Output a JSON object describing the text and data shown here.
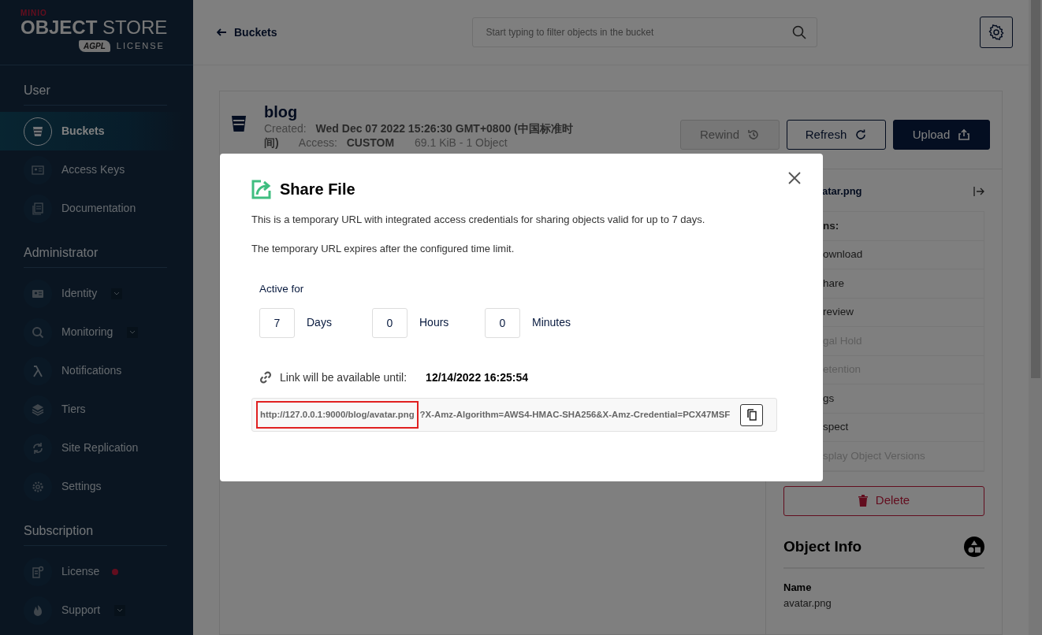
{
  "sidebar": {
    "logo": {
      "brand": "MINIO",
      "title_bold": "OBJECT",
      "title_light": "STORE",
      "badge": "AGPL",
      "edition": "LICENSE"
    },
    "sections": [
      {
        "title": "User",
        "items": [
          {
            "label": "Buckets",
            "kind": "bucket",
            "selected": true,
            "expandable": false,
            "alert": false
          },
          {
            "label": "Access Keys",
            "kind": "id",
            "selected": false,
            "expandable": false,
            "alert": false
          },
          {
            "label": "Documentation",
            "kind": "doc",
            "selected": false,
            "expandable": false,
            "alert": false
          }
        ]
      },
      {
        "title": "Administrator",
        "items": [
          {
            "label": "Identity",
            "kind": "card",
            "selected": false,
            "expandable": true,
            "alert": false
          },
          {
            "label": "Monitoring",
            "kind": "search",
            "selected": false,
            "expandable": true,
            "alert": false
          },
          {
            "label": "Notifications",
            "kind": "lambda",
            "selected": false,
            "expandable": false,
            "alert": false
          },
          {
            "label": "Tiers",
            "kind": "layers",
            "selected": false,
            "expandable": false,
            "alert": false
          },
          {
            "label": "Site Replication",
            "kind": "sync",
            "selected": false,
            "expandable": false,
            "alert": false
          },
          {
            "label": "Settings",
            "kind": "gear",
            "selected": false,
            "expandable": false,
            "alert": false
          }
        ]
      },
      {
        "title": "Subscription",
        "items": [
          {
            "label": "License",
            "kind": "license",
            "selected": false,
            "expandable": false,
            "alert": true
          },
          {
            "label": "Support",
            "kind": "flame",
            "selected": false,
            "expandable": true,
            "alert": false
          }
        ]
      }
    ]
  },
  "topbar": {
    "back": "Buckets",
    "search": {
      "placeholder": "Start typing to filter objects in the bucket"
    }
  },
  "bucket": {
    "name": "blog",
    "created_label": "Created:",
    "created_value": "Wed Dec 07 2022 15:26:30 GMT+0800 (中国标准时间)",
    "access_label": "Access:",
    "access_value": "CUSTOM",
    "size": "69.1 KiB - 1 Object",
    "buttons": [
      {
        "label": "Rewind",
        "kind": "rewind",
        "disabled": true
      },
      {
        "label": "Refresh",
        "kind": "refresh",
        "disabled": false
      },
      {
        "label": "Upload",
        "kind": "upload",
        "disabled": false
      }
    ]
  },
  "details": {
    "file_name": "atar.png",
    "actions_title": "ns:",
    "actions": [
      {
        "label": "ownload",
        "disabled": false
      },
      {
        "label": "hare",
        "disabled": false
      },
      {
        "label": "review",
        "disabled": false
      },
      {
        "label": "gal Hold",
        "disabled": true
      },
      {
        "label": "etention",
        "disabled": true
      },
      {
        "label": "gs",
        "disabled": false
      },
      {
        "label": "spect",
        "disabled": false
      },
      {
        "label": "splay Object Versions",
        "disabled": true
      }
    ],
    "delete": "Delete",
    "info_title": "Object Info",
    "name_label": "Name",
    "name_value": "avatar.png"
  },
  "modal": {
    "title": "Share File",
    "paragraphs": [
      "This is a temporary URL with integrated access credentials for sharing objects valid for up to 7 days.",
      "The temporary URL expires after the configured time limit."
    ],
    "active_for": "Active for",
    "durations": [
      {
        "value": "7",
        "unit": "Days"
      },
      {
        "value": "0",
        "unit": "Hours"
      },
      {
        "value": "0",
        "unit": "Minutes"
      }
    ],
    "link_label": "Link will be available until:",
    "link_until": "12/14/2022 16:25:54",
    "url": [
      {
        "text": "http://127.0.0.1:9000/blog/avatar.png",
        "highlighted": true
      },
      {
        "text": "?X-Amz-Algorithm=AWS4-HMAC-SHA256&X-Amz-Credential=PCX47MSF",
        "highlighted": false
      }
    ]
  }
}
